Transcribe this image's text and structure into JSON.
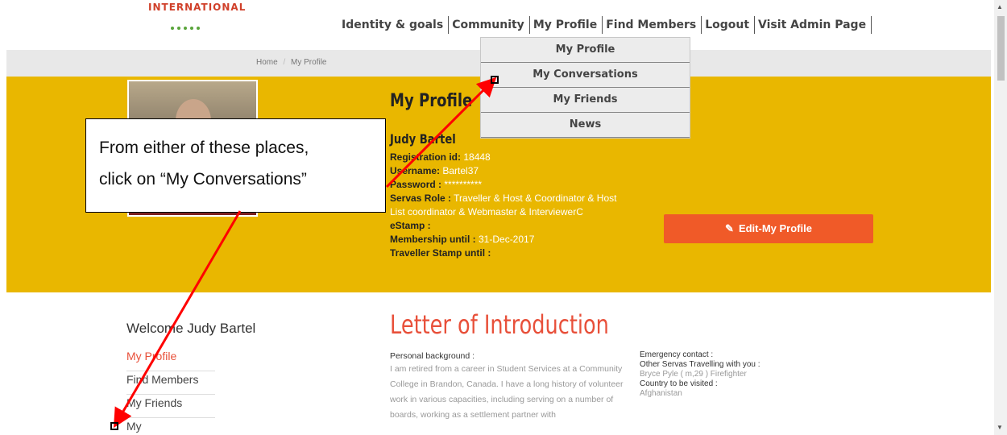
{
  "logo": {
    "text": "INTERNATIONAL"
  },
  "topnav": [
    "Identity & goals",
    "Community",
    "My Profile",
    "Find Members",
    "Logout",
    "Visit Admin Page"
  ],
  "dropdown": [
    "My Profile",
    "My Conversations",
    "My Friends",
    "News"
  ],
  "breadcrumb": {
    "home": "Home",
    "sep": "/",
    "current": "My Profile"
  },
  "profile": {
    "title": "My Profile",
    "name": "Judy Bartel",
    "fields": [
      {
        "label": "Registration id:",
        "value": " 18448"
      },
      {
        "label": "Username:",
        "value": " Bartel37"
      },
      {
        "label": "Password :",
        "value": " **********"
      },
      {
        "label": "Servas Role :",
        "value": " Traveller & Host & Coordinator & Host List coordinator & Webmaster & InterviewerC"
      },
      {
        "label": "eStamp :",
        "value": ""
      },
      {
        "label": "Membership until :",
        "value": " 31-Dec-2017"
      },
      {
        "label": "Traveller Stamp until :",
        "value": ""
      }
    ],
    "edit_button": "Edit-My Profile"
  },
  "welcome": "Welcome Judy Bartel",
  "sidenav": [
    "My Profile",
    "Find Members",
    "My Friends",
    "My Conversations"
  ],
  "letter": {
    "title": "Letter of Introduction",
    "personal_background_label": "Personal background :",
    "personal_background_text": "I am retired from a career in Student Services at a Community College in Brandon, Canada. I have a long history of volunteer work in various capacities, including serving on a number of boards, working as a settlement partner with",
    "emergency_contact_label": "Emergency contact :",
    "other_servas_label": "Other Servas Travelling with you :",
    "other_servas_value": "Bryce Pyle ( m,29 ) Firefighter",
    "country_label": "Country to be visited :",
    "country_value": "Afghanistan"
  },
  "callout": {
    "line1": "From either of these places,",
    "line2": "click on “My Conversations”"
  },
  "colors": {
    "band": "#e9b700",
    "accent": "#e8503a",
    "button": "#f05a28",
    "arrow": "#ff0000"
  },
  "icons": {
    "edit": "pencil-icon",
    "scroll_up": "triangle-up-icon",
    "scroll_down": "triangle-down-icon"
  }
}
